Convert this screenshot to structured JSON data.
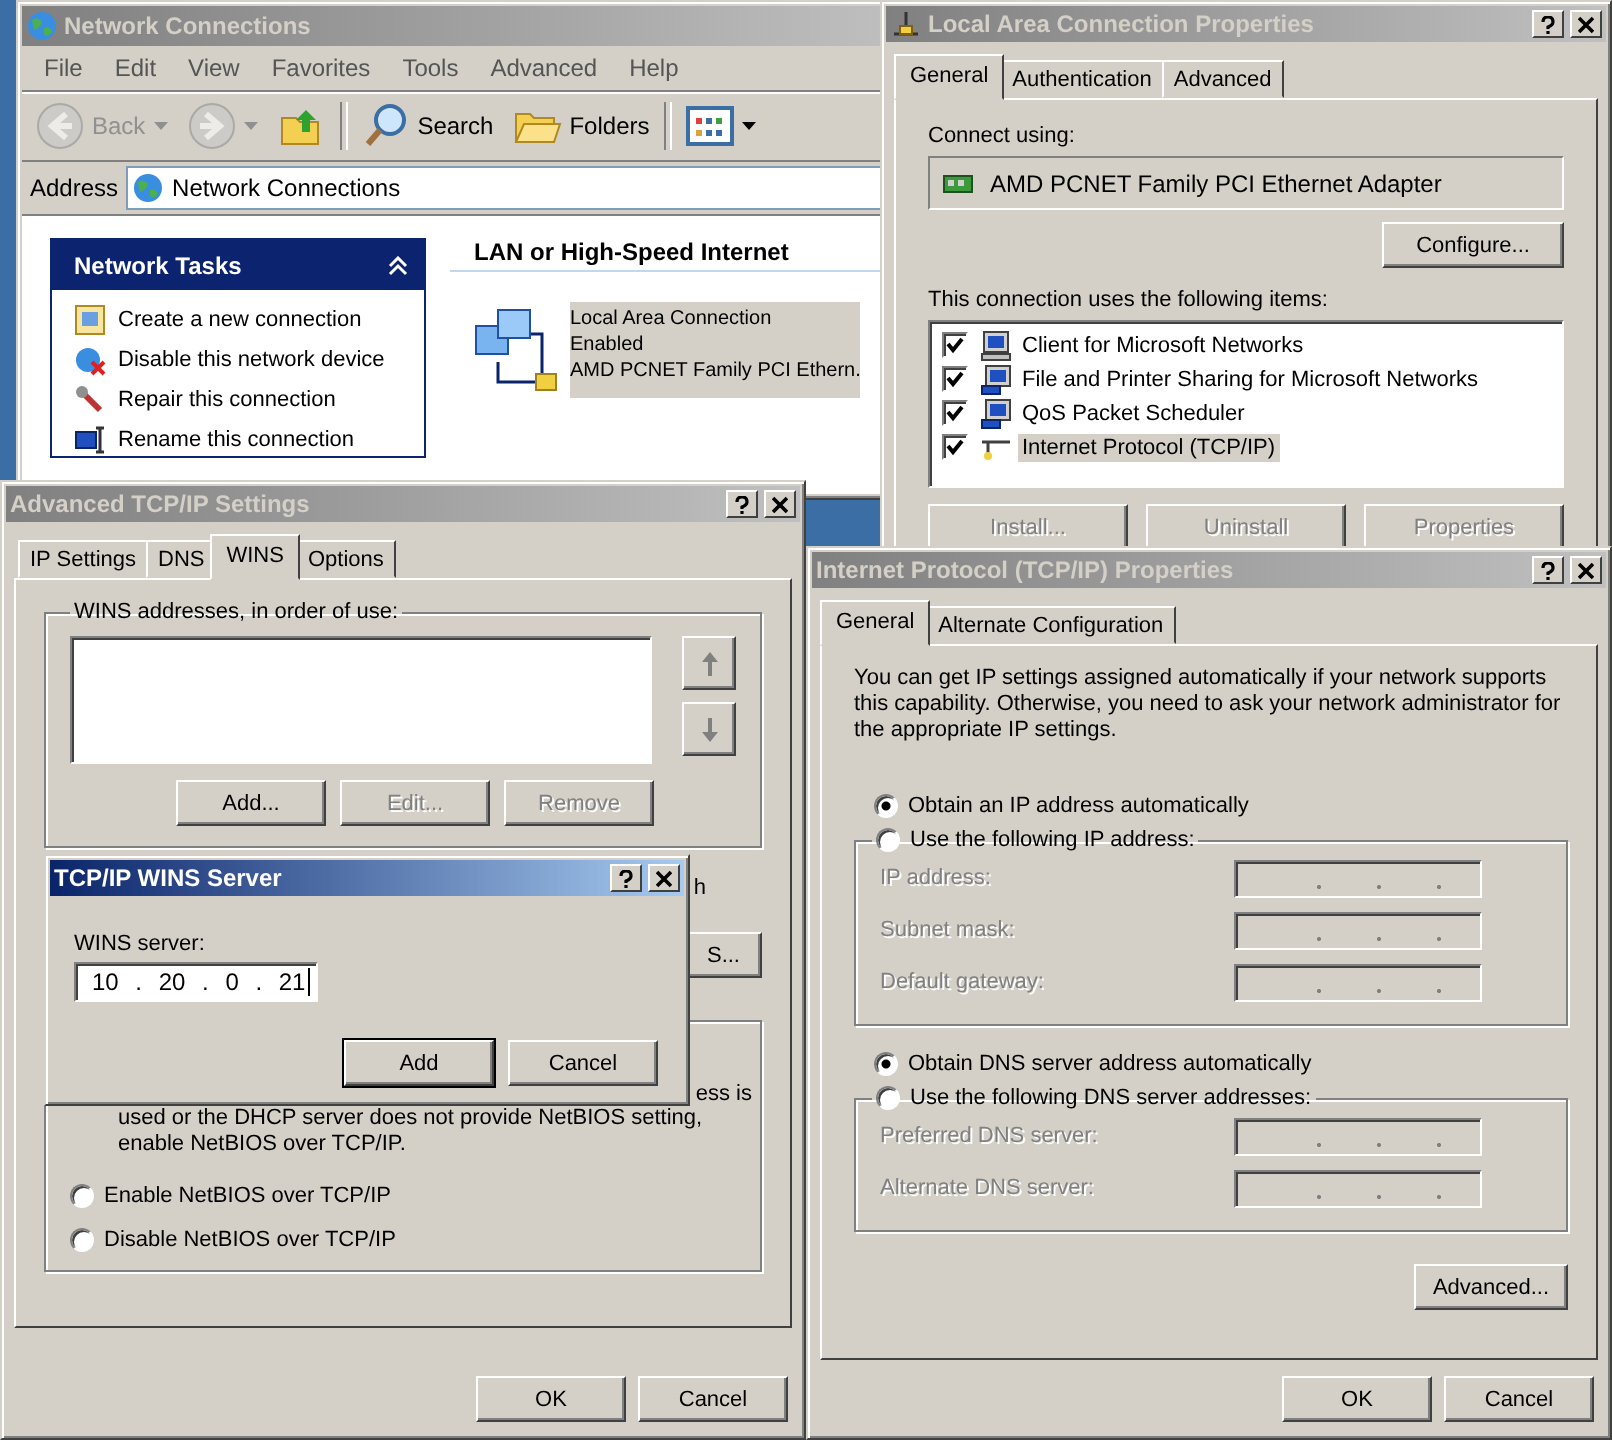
{
  "network_connections": {
    "title": "Network Connections",
    "active": false,
    "menu": [
      "File",
      "Edit",
      "View",
      "Favorites",
      "Tools",
      "Advanced",
      "Help"
    ],
    "toolbar": [
      {
        "kind": "back",
        "label": "Back",
        "disabled": true
      },
      {
        "kind": "forward",
        "disabled": true
      },
      {
        "kind": "up",
        "disabled": false
      },
      {
        "kind": "search",
        "label": "Search",
        "disabled": false
      },
      {
        "kind": "folders",
        "label": "Folders",
        "disabled": false
      },
      {
        "kind": "views",
        "disabled": false
      }
    ],
    "address": {
      "label": "Address",
      "value": "Network Connections"
    },
    "tasks": {
      "title": "Network Tasks",
      "items": [
        {
          "kind": "create",
          "label": "Create a new connection"
        },
        {
          "kind": "disable",
          "label": "Disable this network device"
        },
        {
          "kind": "repair",
          "label": "Repair this connection"
        },
        {
          "kind": "rename",
          "label": "Rename this connection"
        }
      ]
    },
    "section_title": "LAN or High-Speed Internet",
    "connection": {
      "name": "Local Area Connection",
      "status": "Enabled",
      "device": "AMD PCNET Family PCI Ethern.",
      "selected": true
    }
  },
  "lan_properties": {
    "title": "Local Area Connection Properties",
    "active": false,
    "tabs": [
      {
        "label": "General",
        "selected": true
      },
      {
        "label": "Authentication",
        "selected": false
      },
      {
        "label": "Advanced",
        "selected": false
      }
    ],
    "connect_label": "Connect using:",
    "adapter": "AMD PCNET Family PCI Ethernet Adapter",
    "configure": "Configure...",
    "items_label": "This connection uses the following items:",
    "items": [
      {
        "kind": "client",
        "label": "Client for Microsoft Networks",
        "checked": true,
        "selected": false
      },
      {
        "kind": "service",
        "label": "File and Printer Sharing for Microsoft Networks",
        "checked": true,
        "selected": false
      },
      {
        "kind": "service",
        "label": "QoS Packet Scheduler",
        "checked": true,
        "selected": false
      },
      {
        "kind": "protocol",
        "label": "Internet Protocol (TCP/IP)",
        "checked": true,
        "selected": true
      }
    ],
    "buttons": [
      {
        "label": "Install...",
        "disabled": true
      },
      {
        "label": "Uninstall",
        "disabled": true
      },
      {
        "label": "Properties",
        "disabled": true
      }
    ]
  },
  "advanced_tcpip": {
    "title": "Advanced TCP/IP Settings",
    "active": false,
    "tabs": [
      {
        "label": "IP Settings",
        "selected": false
      },
      {
        "label": "DNS",
        "selected": false
      },
      {
        "label": "WINS",
        "selected": true
      },
      {
        "label": "Options",
        "selected": false
      }
    ],
    "wins_label": "WINS addresses, in order of use:",
    "wins_buttons": [
      {
        "label": "Add...",
        "disabled": false
      },
      {
        "label": "Edit...",
        "disabled": true
      },
      {
        "label": "Remove",
        "disabled": true
      }
    ],
    "lmhosts_fragment": "h",
    "import_fragment": "S...",
    "netbios_fragment": "ess is",
    "netbios_text": "used or the DHCP server does not provide NetBIOS setting, enable NetBIOS over TCP/IP.",
    "netbios_options": [
      {
        "label": "Enable NetBIOS over TCP/IP",
        "selected": false
      },
      {
        "label": "Disable NetBIOS over TCP/IP",
        "selected": false
      }
    ],
    "buttons": [
      "OK",
      "Cancel"
    ]
  },
  "wins_server": {
    "title": "TCP/IP WINS Server",
    "active": true,
    "field_label": "WINS server:",
    "value": "10 . 20 . 0 . 21",
    "buttons": [
      {
        "label": "Add",
        "default": true
      },
      {
        "label": "Cancel",
        "default": false
      }
    ]
  },
  "tcpip_properties": {
    "title": "Internet Protocol (TCP/IP) Properties",
    "active": false,
    "tabs": [
      {
        "label": "General",
        "selected": true
      },
      {
        "label": "Alternate Configuration",
        "selected": false
      }
    ],
    "intro": "You can get IP settings assigned automatically if your network supports this capability. Otherwise, you need to ask your network administrator for the appropriate IP settings.",
    "ip_auto": {
      "label": "Obtain an IP address automatically",
      "selected": true
    },
    "ip_manual": {
      "label": "Use the following IP address:",
      "selected": false
    },
    "ip_fields": [
      {
        "label": "IP address:",
        "disabled": true
      },
      {
        "label": "Subnet mask:",
        "disabled": true
      },
      {
        "label": "Default gateway:",
        "disabled": true
      }
    ],
    "dns_auto": {
      "label": "Obtain DNS server address automatically",
      "selected": true
    },
    "dns_manual": {
      "label": "Use the following DNS server addresses:",
      "selected": false
    },
    "dns_fields": [
      {
        "label": "Preferred DNS server:",
        "disabled": true
      },
      {
        "label": "Alternate DNS server:",
        "disabled": true
      }
    ],
    "advanced": "Advanced...",
    "buttons": [
      "OK",
      "Cancel"
    ]
  }
}
